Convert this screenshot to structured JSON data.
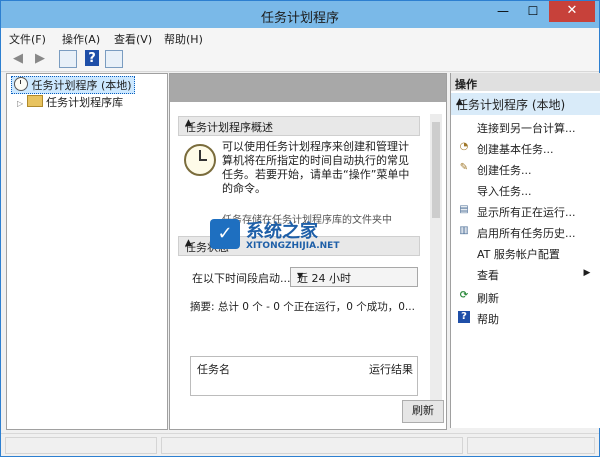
{
  "window": {
    "title": "任务计划程序",
    "minimize": "—",
    "maximize": "☐",
    "close": "✕"
  },
  "menu": [
    "文件(F)",
    "操作(A)",
    "查看(V)",
    "帮助(H)"
  ],
  "toolbar": {
    "back": "◀",
    "forward": "▶",
    "help": "?"
  },
  "tree": {
    "root": "任务计划程序 (本地)",
    "child": "任务计划程序库",
    "expander": "▷"
  },
  "overview": {
    "title": "任务计划程序概述",
    "description": "可以使用任务计划程序来创建和管理计算机将在所指定的时间自动执行的常见任务。若要开始，请单击“操作”菜单中的命令。",
    "truncated": "任务存储在任务计划程序库的文件夹中"
  },
  "watermark": {
    "cn": "系统之家",
    "en": "XITONGZHIJIA.NET",
    "logo": "✓"
  },
  "status": {
    "title": "任务状态",
    "period_label": "在以下时间段启动...",
    "period_value": "近 24 小时",
    "summary": "摘要: 总计 0 个 - 0 个正在运行，0 个成功，0...",
    "col_name": "任务名",
    "col_result": "运行结果",
    "refresh": "刷新"
  },
  "actions": {
    "pane_title": "操作",
    "group": "任务计划程序 (本地)",
    "items": [
      {
        "label": "连接到另一台计算...",
        "icon": ""
      },
      {
        "label": "创建基本任务...",
        "icon": "◔"
      },
      {
        "label": "创建任务...",
        "icon": "✎"
      },
      {
        "label": "导入任务...",
        "icon": ""
      },
      {
        "label": "显示所有正在运行...",
        "icon": "▤"
      },
      {
        "label": "启用所有任务历史...",
        "icon": "▥"
      },
      {
        "label": "AT 服务帐户配置",
        "icon": ""
      },
      {
        "label": "查看",
        "icon": ""
      },
      {
        "label": "刷新",
        "icon": "⟳"
      },
      {
        "label": "帮助",
        "icon": "?"
      }
    ],
    "submenu_arrow": "▶",
    "collapse": "▲"
  },
  "caret": "▲",
  "dropdown_arrow": "▼"
}
